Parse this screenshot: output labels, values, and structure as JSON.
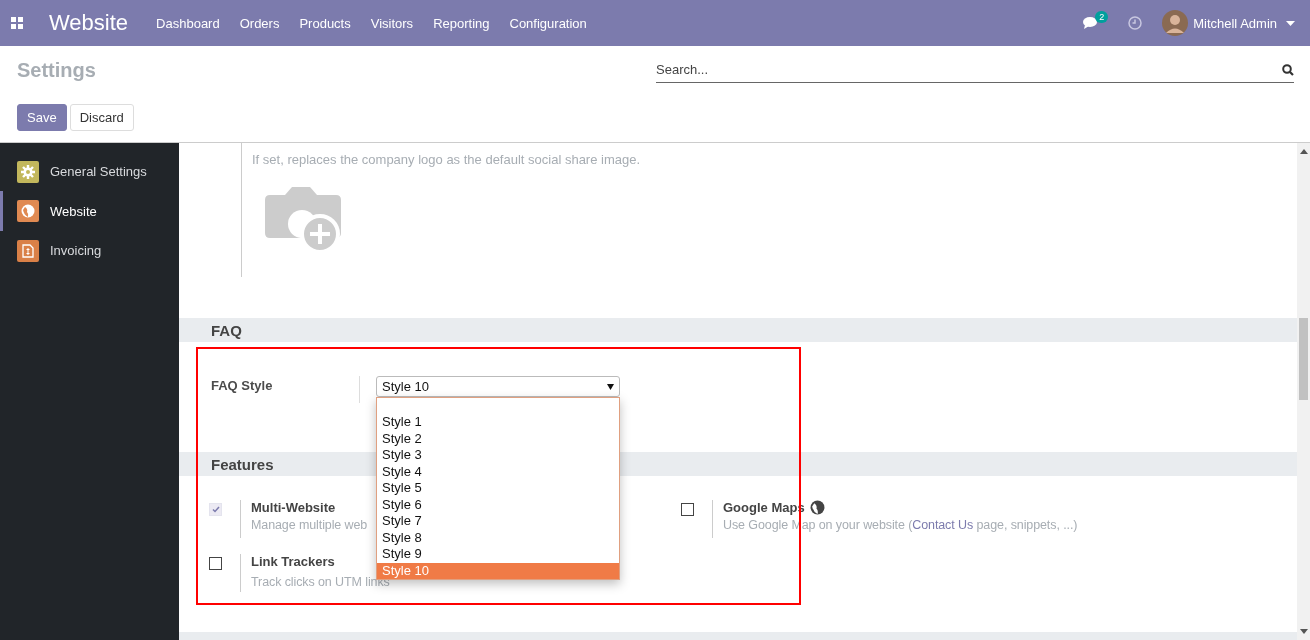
{
  "navbar": {
    "app_title": "Website",
    "menu": [
      "Dashboard",
      "Orders",
      "Products",
      "Visitors",
      "Reporting",
      "Configuration"
    ],
    "messages_badge": "2",
    "user_name": "Mitchell Admin"
  },
  "control_panel": {
    "title": "Settings",
    "search": {
      "placeholder": "Search..."
    },
    "buttons": [
      {
        "label": "Save",
        "kind": "primary"
      },
      {
        "label": "Discard",
        "kind": "secondary"
      }
    ]
  },
  "sidebar": {
    "items": [
      {
        "label": "General Settings",
        "color": "#c2b75c",
        "selected": false
      },
      {
        "label": "Website",
        "color": "#e08a52",
        "selected": true
      },
      {
        "label": "Invoicing",
        "color": "#d98047",
        "selected": false
      }
    ]
  },
  "share_image": {
    "description": "If set, replaces the company logo as the default social share image."
  },
  "faq": {
    "header": "FAQ",
    "field_label": "FAQ Style",
    "value": "Style 10",
    "options": [
      {
        "label": "Style 1",
        "selected": false
      },
      {
        "label": "Style 2",
        "selected": false
      },
      {
        "label": "Style 3",
        "selected": false
      },
      {
        "label": "Style 4",
        "selected": false
      },
      {
        "label": "Style 5",
        "selected": false
      },
      {
        "label": "Style 6",
        "selected": false
      },
      {
        "label": "Style 7",
        "selected": false
      },
      {
        "label": "Style 8",
        "selected": false
      },
      {
        "label": "Style 9",
        "selected": false
      },
      {
        "label": "Style 10",
        "selected": true
      }
    ]
  },
  "features": {
    "header": "Features",
    "items": [
      {
        "title": "Multi-Website",
        "description": "Manage multiple web",
        "checked": true,
        "disabled": true
      },
      {
        "title": "Google Maps",
        "description_before": "Use Google Map on your website (",
        "link": "Contact Us",
        "description_after": " page, snippets, ...)",
        "checked": false,
        "disabled": false,
        "globe": true
      },
      {
        "title": "Link Trackers",
        "description": "Track clicks on UTM links",
        "checked": false,
        "disabled": false
      }
    ]
  }
}
